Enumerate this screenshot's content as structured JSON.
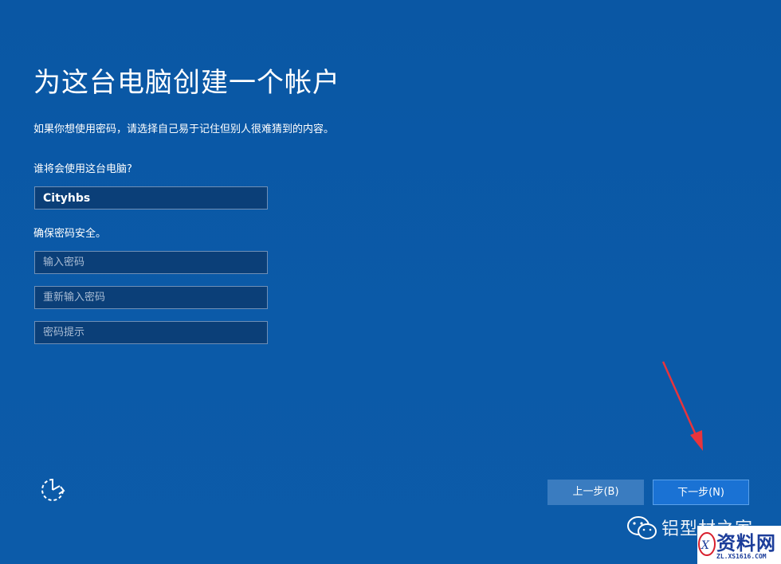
{
  "page": {
    "title": "为这台电脑创建一个帐户",
    "description": "如果你想使用密码，请选择自己易于记住但别人很难猜到的内容。"
  },
  "user": {
    "label": "谁将会使用这台电脑?",
    "value": "Cityhbs"
  },
  "security": {
    "label": "确保密码安全。",
    "password_placeholder": "输入密码",
    "confirm_placeholder": "重新输入密码",
    "hint_placeholder": "密码提示"
  },
  "buttons": {
    "back": "上一步(B)",
    "next": "下一步(N)"
  },
  "watermark": {
    "text": "铝型材之家",
    "logo_text": "资料网",
    "logo_url_text": "ZL.XS1616.COM"
  },
  "colors": {
    "background": "#0b59a6",
    "field_bg": "#0b3f78",
    "back_button": "#3a7cc0",
    "next_button": "#1a72d4",
    "arrow": "#e8343c"
  },
  "icons": {
    "accessibility": "ease-of-access-icon",
    "annotation": "red-arrow-icon",
    "wechat": "wechat-icon"
  }
}
